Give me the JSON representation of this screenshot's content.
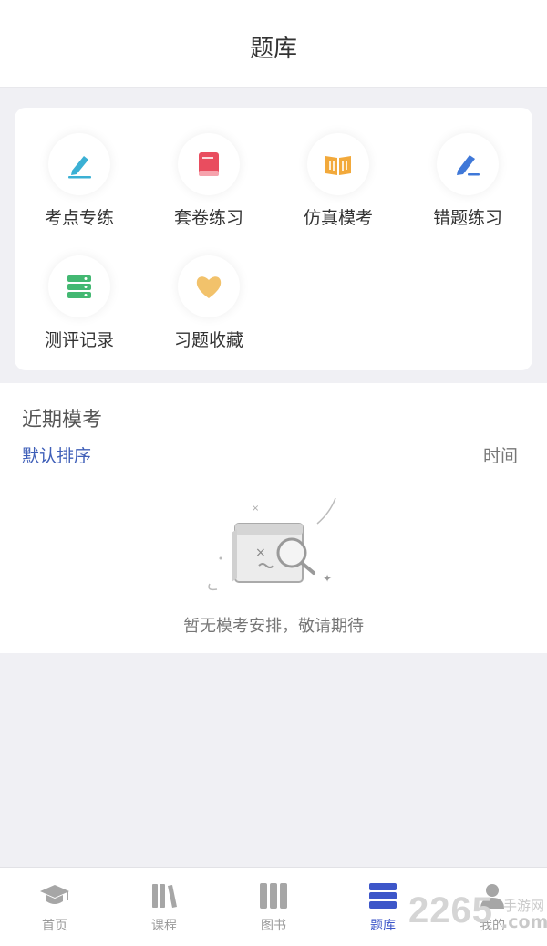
{
  "header": {
    "title": "题库"
  },
  "menu": {
    "items": [
      {
        "label": "考点专练",
        "icon": "pen-icon",
        "color": "#3bb0d4"
      },
      {
        "label": "套卷练习",
        "icon": "book-icon",
        "color": "#e94d5f"
      },
      {
        "label": "仿真模考",
        "icon": "open-book-icon",
        "color": "#f2a93b"
      },
      {
        "label": "错题练习",
        "icon": "edit-icon",
        "color": "#3f78d8"
      },
      {
        "label": "测评记录",
        "icon": "records-icon",
        "color": "#43b872"
      },
      {
        "label": "习题收藏",
        "icon": "heart-icon",
        "color": "#f2c26b"
      }
    ]
  },
  "recent": {
    "title": "近期模考",
    "sort_default": "默认排序",
    "sort_time": "时间",
    "empty_text": "暂无模考安排，敬请期待"
  },
  "tabbar": {
    "items": [
      {
        "label": "首页",
        "icon": "graduation-cap-icon",
        "active": false
      },
      {
        "label": "课程",
        "icon": "books-icon",
        "active": false
      },
      {
        "label": "图书",
        "icon": "library-icon",
        "active": false
      },
      {
        "label": "题库",
        "icon": "question-bank-icon",
        "active": true
      },
      {
        "label": "我的",
        "icon": "user-icon",
        "active": false
      }
    ]
  },
  "watermark": {
    "number": "2265",
    "text": "手游网",
    "domain": ".com"
  },
  "colors": {
    "accent": "#3d56c9",
    "sort_link": "#3f5fb8",
    "background": "#f0f0f4"
  }
}
